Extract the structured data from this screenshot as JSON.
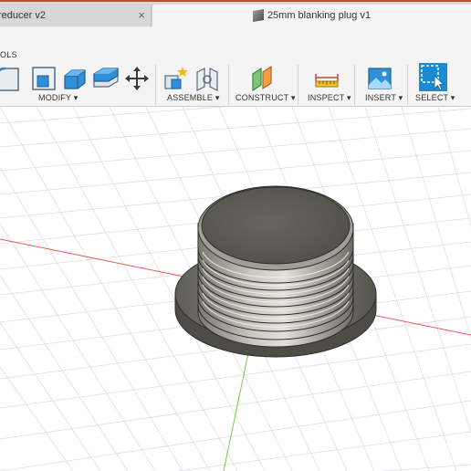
{
  "tabs": {
    "inactive": {
      "title": "reducer v2",
      "close": "×"
    },
    "active": {
      "title": "25mm blanking plug v1"
    }
  },
  "toolbar": {
    "tools_label": "OLS",
    "groups": {
      "modify": "MODIFY ▾",
      "assemble": "ASSEMBLE ▾",
      "construct": "CONSTRUCT ▾",
      "inspect": "INSPECT ▾",
      "insert": "INSERT ▾",
      "select": "SELECT ▾"
    },
    "icons": [
      "fillet-icon",
      "press-pull-icon",
      "shell-icon",
      "combine-icon",
      "move-icon",
      "new-component-icon",
      "joint-icon",
      "offset-plane-icon",
      "measure-icon",
      "insert-image-icon",
      "select-icon"
    ]
  },
  "colors": {
    "select_accent": "#1a8ad4",
    "x_axis": "#e45a5a",
    "y_axis": "#7ac943",
    "grid": "#d9dee3"
  },
  "viewport": {
    "model": "threaded blanking plug"
  }
}
